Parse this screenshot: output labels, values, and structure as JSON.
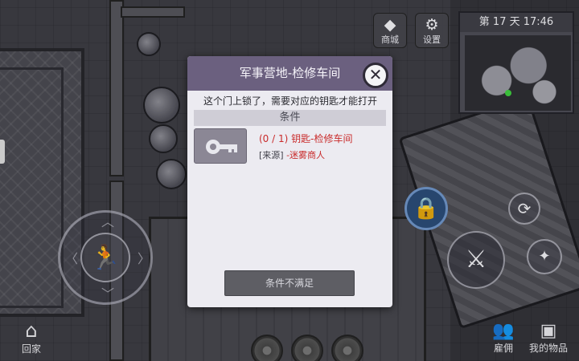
{
  "hud": {
    "day_time": "第 17 天   17:46",
    "shop_label": "商城",
    "settings_label": "设置",
    "home_label": "回家",
    "hire_label": "雇佣",
    "inventory_label": "我的物品"
  },
  "dialog": {
    "title": "军事营地-检修车间",
    "message": "这个门上锁了，需要对应的钥匙才能打开",
    "conditions_header": "条件",
    "requirement_progress": "(0 / 1) 钥匙-检修车间",
    "source_prefix": "[来源]",
    "source_value": " -迷雾商人",
    "unmet_button": "条件不满足"
  },
  "icons": {
    "shop": "diamond-icon",
    "settings": "gear-icon",
    "close": "close-icon",
    "key": "key-icon",
    "lock": "lock-icon",
    "home": "house-icon",
    "hire": "people-icon",
    "inventory": "chest-icon",
    "run": "running-man-icon",
    "weapon": "machete-icon"
  },
  "colors": {
    "dialog_header": "#6b607f",
    "requirement_text": "#c92b2b",
    "lock_button": "#2b4c78"
  }
}
